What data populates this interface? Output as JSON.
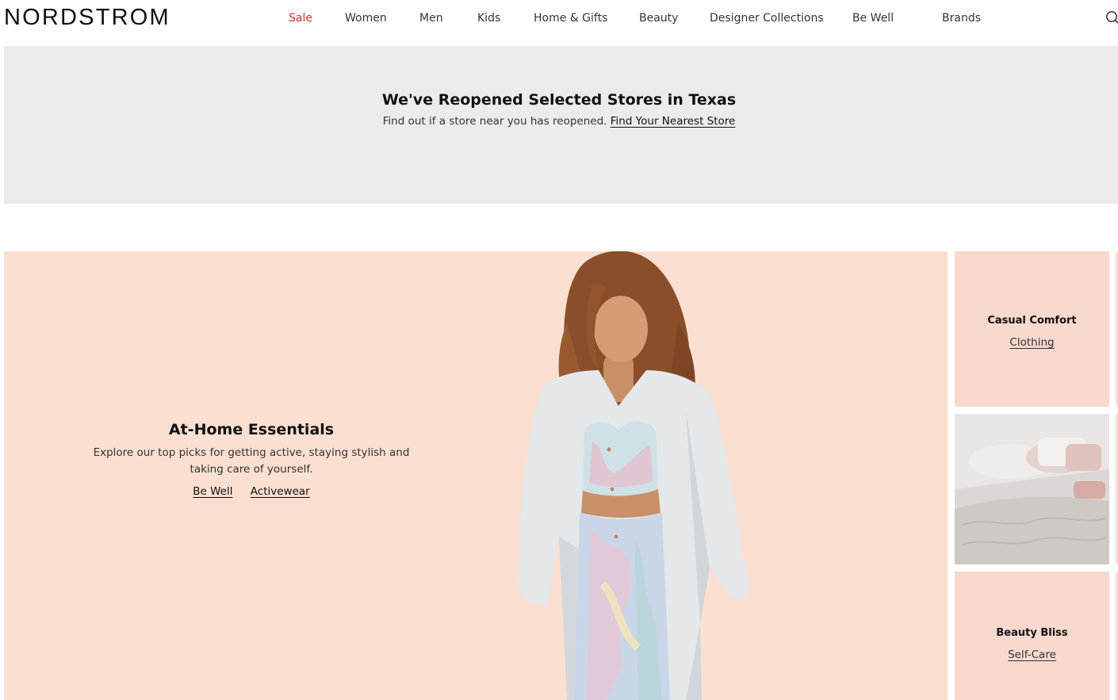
{
  "brand": {
    "logo": "NORDSTROM"
  },
  "nav": {
    "items": [
      {
        "label": "Sale"
      },
      {
        "label": "Women"
      },
      {
        "label": "Men"
      },
      {
        "label": "Kids"
      },
      {
        "label": "Home & Gifts"
      },
      {
        "label": "Beauty"
      },
      {
        "label": "Designer Collections"
      },
      {
        "label": "Be Well"
      },
      {
        "label": "Brands"
      }
    ],
    "search_icon": "search-icon"
  },
  "banner": {
    "title": "We've Reopened Selected Stores in Texas",
    "text": "Find out if a store near you has reopened.",
    "link": "Find Your Nearest Store"
  },
  "hero": {
    "title": "At-Home Essentials",
    "description": "Explore our top picks for getting active, staying stylish and taking care of yourself.",
    "links": [
      "Be Well",
      "Activewear"
    ]
  },
  "tiles": {
    "casual": {
      "title": "Casual Comfort",
      "link": "Clothing"
    },
    "beauty": {
      "title": "Beauty Bliss",
      "link": "Self-Care"
    }
  },
  "colors": {
    "sale": "#d12d2d",
    "banner_bg": "#ebebeb",
    "hero_bg": "#fbdfd1",
    "tile_bg": "#f9d8ce"
  }
}
